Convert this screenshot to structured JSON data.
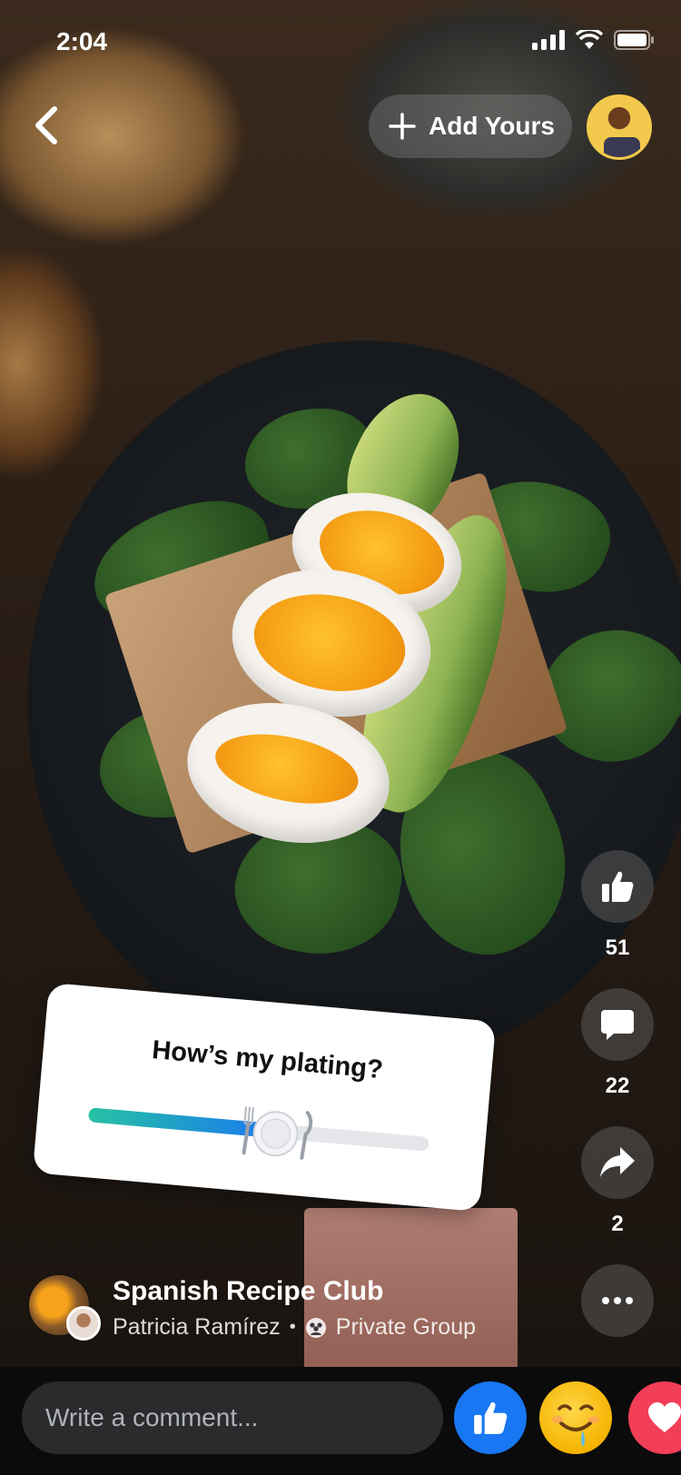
{
  "status_bar": {
    "time": "2:04"
  },
  "header": {
    "add_yours_label": "Add Yours"
  },
  "actions": {
    "likes": "51",
    "comments": "22",
    "shares": "2"
  },
  "poll": {
    "question": "How’s my plating?",
    "value": 0.55,
    "colors": {
      "start": "#27c2a3",
      "end": "#1877f2"
    }
  },
  "group": {
    "name": "Spanish Recipe Club",
    "author": "Patricia Ramírez",
    "separator": "•",
    "privacy": "Private Group"
  },
  "composer": {
    "placeholder": "Write a comment..."
  },
  "icons": [
    "back-chevron",
    "plus",
    "thumbs-up",
    "comment-bubble",
    "share-arrow",
    "more-dots",
    "group-privacy",
    "drooling-face",
    "heart"
  ],
  "colors": {
    "accent": "#1877f2",
    "love": "#f33e58"
  }
}
